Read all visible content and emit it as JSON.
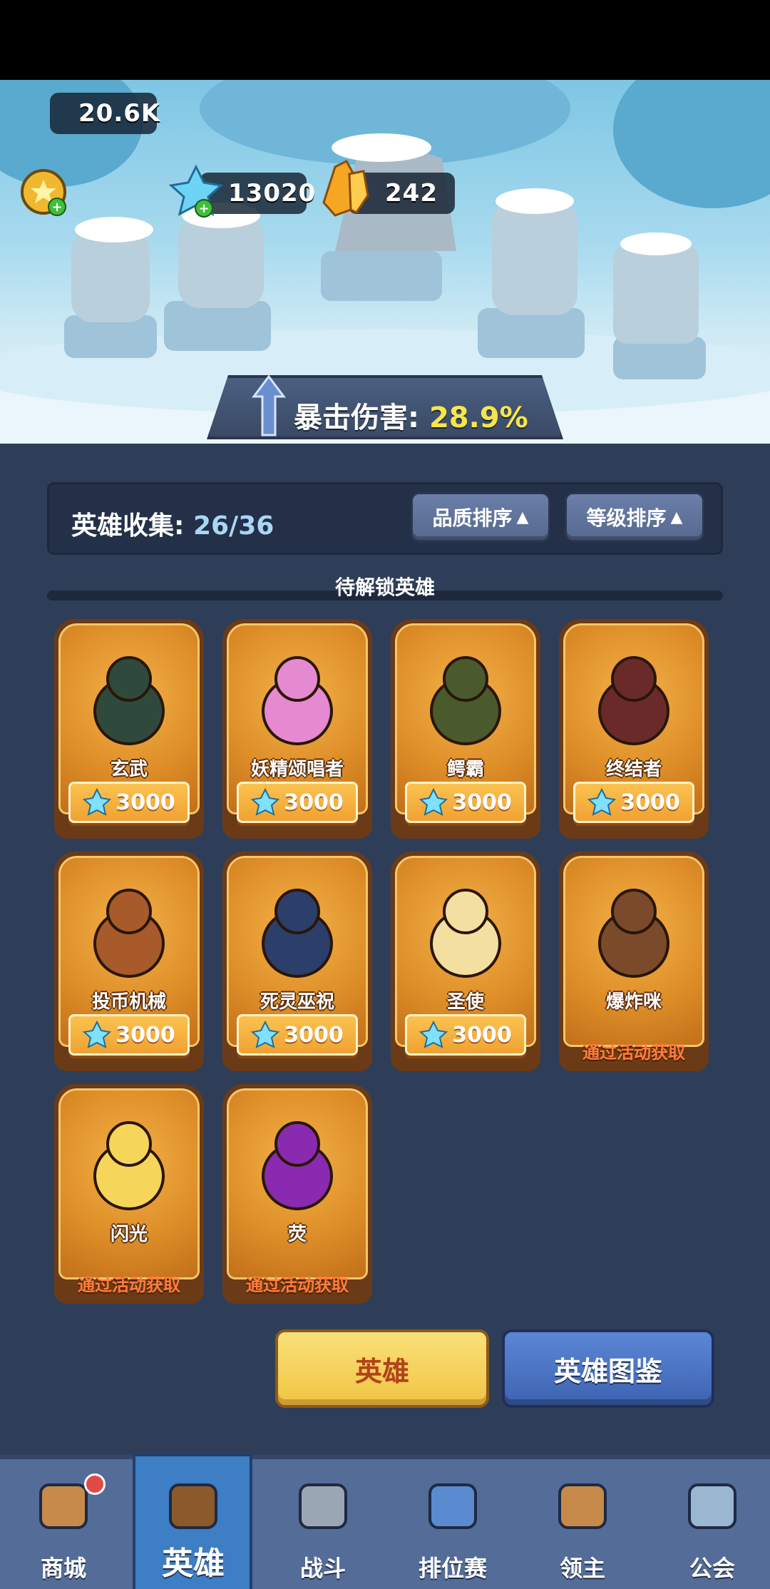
{
  "resources": {
    "gold": "20.6K",
    "gems": "13020",
    "crystals": "242"
  },
  "crit": {
    "label": "暴击伤害:",
    "value": "28.9%"
  },
  "collection": {
    "label": "英雄收集:",
    "count": "26/36",
    "sort_quality": "品质排序",
    "sort_level": "等级排序"
  },
  "section_title": "待解锁英雄",
  "heroes": [
    {
      "name": "玄武",
      "price": "3000"
    },
    {
      "name": "妖精颂唱者",
      "price": "3000"
    },
    {
      "name": "鳄霸",
      "price": "3000"
    },
    {
      "name": "终结者",
      "price": "3000"
    },
    {
      "name": "投币机械",
      "price": "3000"
    },
    {
      "name": "死灵巫祝",
      "price": "3000"
    },
    {
      "name": "圣使",
      "price": "3000"
    },
    {
      "name": "爆炸咪",
      "event": "通过活动获取"
    },
    {
      "name": "闪光",
      "event": "通过活动获取"
    },
    {
      "name": "荧",
      "event": "通过活动获取"
    }
  ],
  "buttons": {
    "heroes": "英雄",
    "codex": "英雄图鉴"
  },
  "nav": [
    {
      "label": "商城",
      "icon": "shop-icon"
    },
    {
      "label": "英雄",
      "icon": "hero-card-icon"
    },
    {
      "label": "战斗",
      "icon": "swords-icon"
    },
    {
      "label": "排位赛",
      "icon": "rank-badge-icon"
    },
    {
      "label": "领主",
      "icon": "castle-banner-icon"
    },
    {
      "label": "公会",
      "icon": "guild-tower-icon"
    }
  ],
  "colors": {
    "accent_yellow": "#f7e64b",
    "card_orange": "#df8f28",
    "nav_blue": "#546c98",
    "event_text": "#ff7d3a"
  }
}
